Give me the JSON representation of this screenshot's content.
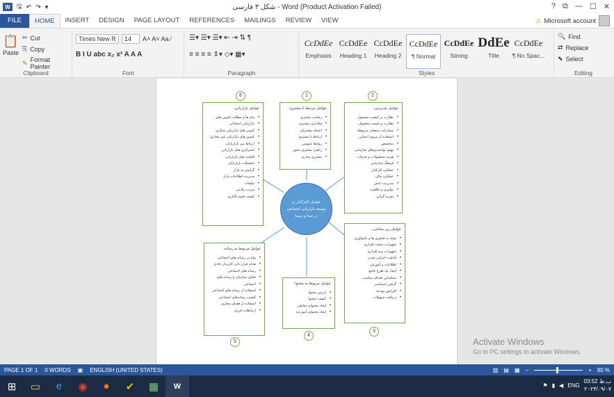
{
  "window": {
    "title": "شکل ۳ فارسی - Word (Product Activation Failed)",
    "help": "?",
    "restore": "⧉",
    "minimize": "—",
    "maximize": "☐",
    "close": "✕",
    "app_icon": "W"
  },
  "quick_access": {
    "save": "🖫",
    "undo": "↶",
    "redo": "↷",
    "customize": "▾"
  },
  "tabs": [
    "FILE",
    "HOME",
    "INSERT",
    "DESIGN",
    "PAGE LAYOUT",
    "REFERENCES",
    "MAILINGS",
    "REVIEW",
    "VIEW"
  ],
  "account": {
    "label": "Microsoft account",
    "warning_icon": "⚠"
  },
  "clipboard": {
    "paste": "Paste",
    "cut": "Cut",
    "copy": "Copy",
    "format_painter": "Format Painter",
    "group": "Clipboard"
  },
  "font": {
    "name": "Times New R",
    "size": "14",
    "group": "Font",
    "row2": "B  I  U  abc  x₂  x²   A  A  A",
    "grow_shrink": "A˄ A˅  Aa  ⁄"
  },
  "paragraph": {
    "group": "Paragraph",
    "row1": "☰▾ ☰▾ ☰▾  ⇤ ⇥  ⇅  ¶",
    "row2": "≡ ≡ ≡ ≡  ⇕▾  ◇▾  ▦▾"
  },
  "styles": {
    "group": "Styles",
    "items": [
      {
        "preview": "CcDdEe",
        "name": "Emphasis"
      },
      {
        "preview": "CcDdEe",
        "name": "Heading 1"
      },
      {
        "preview": "CcDdEe",
        "name": "Heading 2"
      },
      {
        "preview": "CcDdEe",
        "name": "¶ Normal"
      },
      {
        "preview": "CcDdEe",
        "name": "Strong"
      },
      {
        "preview": "DdEe",
        "name": "Title"
      },
      {
        "preview": "CcDdEe",
        "name": "¶ No Spac..."
      }
    ]
  },
  "editing": {
    "group": "Editing",
    "find": "Find",
    "replace": "Replace",
    "select": "Select"
  },
  "diagram": {
    "center": "عوامل تأثیرگذار بر توسعه بازاریابی اجتماعی در صدا و سیما",
    "boxes": [
      {
        "num": "1",
        "title": "عوامل مرتبط با مشتری:",
        "items": [
          "رضایت مشتری",
          "وفاداری مشتری",
          "اعتماد مشتریان",
          "ارتباط با مشتری",
          "روابط عمومی",
          "راهبرد مشتری محور",
          "مشتری مداری"
        ]
      },
      {
        "num": "2",
        "title": "عوامل مدیریتی:",
        "items": [
          "نظارت بر کیفیت محصول",
          "نظارت بر قیمت محصول",
          "مشارکت ذینفعان مربوطه",
          "استفاده از نیروی انسانی",
          "متخصص",
          "بهبود توانمندی‌های سازمانی",
          "هزینه محصولات و خدمات",
          "فرهنگ سازمانی",
          "عملکرد کارکنان",
          "عملکرد مالی",
          "مدیریت دانش",
          "نوآوری و خلاقیت",
          "تجربه گرایی"
        ]
      },
      {
        "num": "3",
        "title": "عوامل زیر ساختی:",
        "items": [
          "توجه به فناوری ها و تکنولوژی",
          "تجهیزات سخت افزاری",
          "تجهیزات نرم افزاری",
          "قابلیت اجرایی شدن",
          "اطلاعات و آموزش",
          "ایجاد یک طرح جامع",
          "شناسایی اهداف مناسب",
          "گرفتن اسپانسر",
          "افزایش بودجه",
          "دریافت تسهیلات"
        ]
      },
      {
        "num": "4",
        "title": "عوامل مربوط به محتوا :",
        "items": [
          "ارزش محتوا",
          "کیفیت محتوا",
          "ایجاد محتوای تعاملی",
          "ایجاد محتوای آموزنده"
        ]
      },
      {
        "num": "5",
        "title": "عوامل مربوط به رسانه:",
        "items": [
          "پیام در رسانه های اجتماعی",
          "هدف قرار دادن کاربران عادی",
          "رسانه های اجتماعی",
          "تعامل سازمان با رسانه های",
          "اجتماعی",
          "استفاده از رسانه های اجتماعی",
          "کیفیت رسانه‌های اجتماعی",
          "استفاده از فضای مجازی",
          "ارتباطات فردی"
        ]
      },
      {
        "num": "6",
        "title": "عوامل بازاریابی:",
        "items": [
          "پیام ها و مطالب کمپین های",
          "بازاریابی اجتماعی",
          "کمپین های بازاریابی مجازی",
          "کمپین های بازاریابی غیر مجازی",
          "ارتباط بین بازاریابان",
          "استراتژی های بازاریابی",
          "قابلیت های بازاریابی",
          "تحصیلات بازاریابان",
          "گرایش به بازار",
          "مدیریت اطلاعات بازار",
          "تبلیغات",
          "مزیت رقابتی",
          "کیفیت قیمت‌گذاری"
        ]
      }
    ]
  },
  "watermark": {
    "line1": "Activate Windows",
    "line2": "Go to PC settings to activate Windows."
  },
  "status": {
    "page": "PAGE 1 OF 1",
    "words": "0 WORDS",
    "language": "ENGLISH (UNITED STATES)",
    "zoom": "80 %"
  },
  "tray": {
    "lang": "ENG",
    "time": "03:52 ب.ظ",
    "date": "۲۰۲۳/۰۹/۰۷"
  },
  "colors": {
    "accent": "#2b579a",
    "box_border": "#70ad47",
    "circle": "#5b9bd5"
  }
}
